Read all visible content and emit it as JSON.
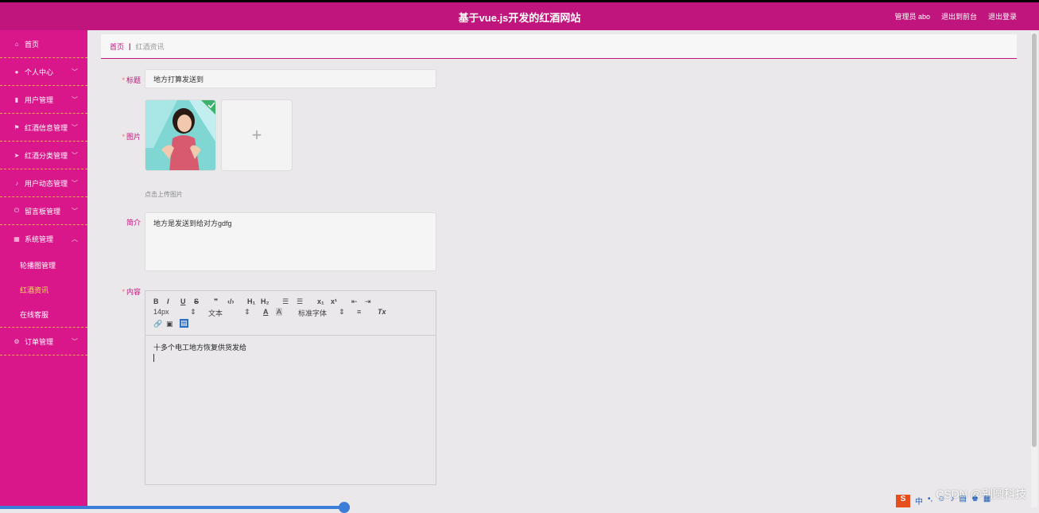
{
  "header": {
    "title": "基于vue.js开发的红酒网站",
    "admin": "管理员 abo",
    "back_front": "退出到前台",
    "logout": "退出登录"
  },
  "sidebar": {
    "items": [
      {
        "label": "首页",
        "icon": "home-icon"
      },
      {
        "label": "个人中心",
        "icon": "user-icon"
      },
      {
        "label": "用户管理",
        "icon": "clipboard-icon"
      },
      {
        "label": "红酒信息管理",
        "icon": "flag-icon"
      },
      {
        "label": "红酒分类管理",
        "icon": "send-icon"
      },
      {
        "label": "用户动态管理",
        "icon": "mic-icon"
      },
      {
        "label": "留言板管理",
        "icon": "power-icon"
      },
      {
        "label": "系统管理",
        "icon": "grid-icon"
      }
    ],
    "sub_items": [
      {
        "label": "轮播图管理"
      },
      {
        "label": "红酒资讯"
      },
      {
        "label": "在线客服"
      }
    ],
    "order": {
      "label": "订单管理",
      "icon": "gear-icon"
    }
  },
  "breadcrumb": {
    "home": "首页",
    "sep": "|",
    "current": "红酒资讯"
  },
  "form": {
    "title_label": "标题",
    "title_value": "地方打算发送到",
    "image_label": "图片",
    "upload_plus": "+",
    "upload_tip": "点击上传图片",
    "intro_label": "简介",
    "intro_value": "地方是发送到给对方gdfg",
    "content_label": "内容",
    "required_mark": "*"
  },
  "editor": {
    "size": "14px",
    "text_type": "文本",
    "font": "标准字体",
    "content_line": "十多个电工地方恢复供货发给"
  },
  "footer": {
    "watermark": "CSDN @别圆科技",
    "ime": "中"
  }
}
